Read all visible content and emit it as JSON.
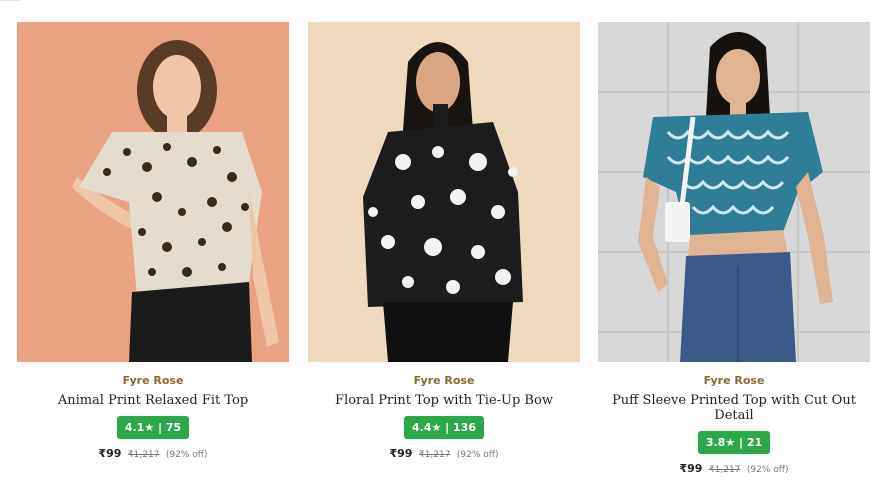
{
  "products": [
    {
      "brand": "Fyre Rose",
      "title": "Animal Print Relaxed Fit Top",
      "rating": "4.1★ | 75",
      "price": "₹99",
      "mrp": "₹1,217",
      "discount": "(92% off)",
      "image_bg": "#e9a383",
      "image_subject": "leopard-print-top"
    },
    {
      "brand": "Fyre Rose",
      "title": "Floral Print Top with Tie-Up Bow",
      "rating": "4.4★ | 136",
      "price": "₹99",
      "mrp": "₹1,217",
      "discount": "(92% off)",
      "image_bg": "#efd9bf",
      "image_subject": "floral-print-top"
    },
    {
      "brand": "Fyre Rose",
      "title": "Puff Sleeve Printed Top with Cut Out Detail",
      "rating": "3.8★ | 21",
      "price": "₹99",
      "mrp": "₹1,217",
      "discount": "(92% off)",
      "image_bg": "#d8d8d8",
      "image_subject": "blue-print-crop-top"
    }
  ],
  "colors": {
    "brand": "#8a6b2e",
    "rating_bg": "#2aa84a"
  }
}
